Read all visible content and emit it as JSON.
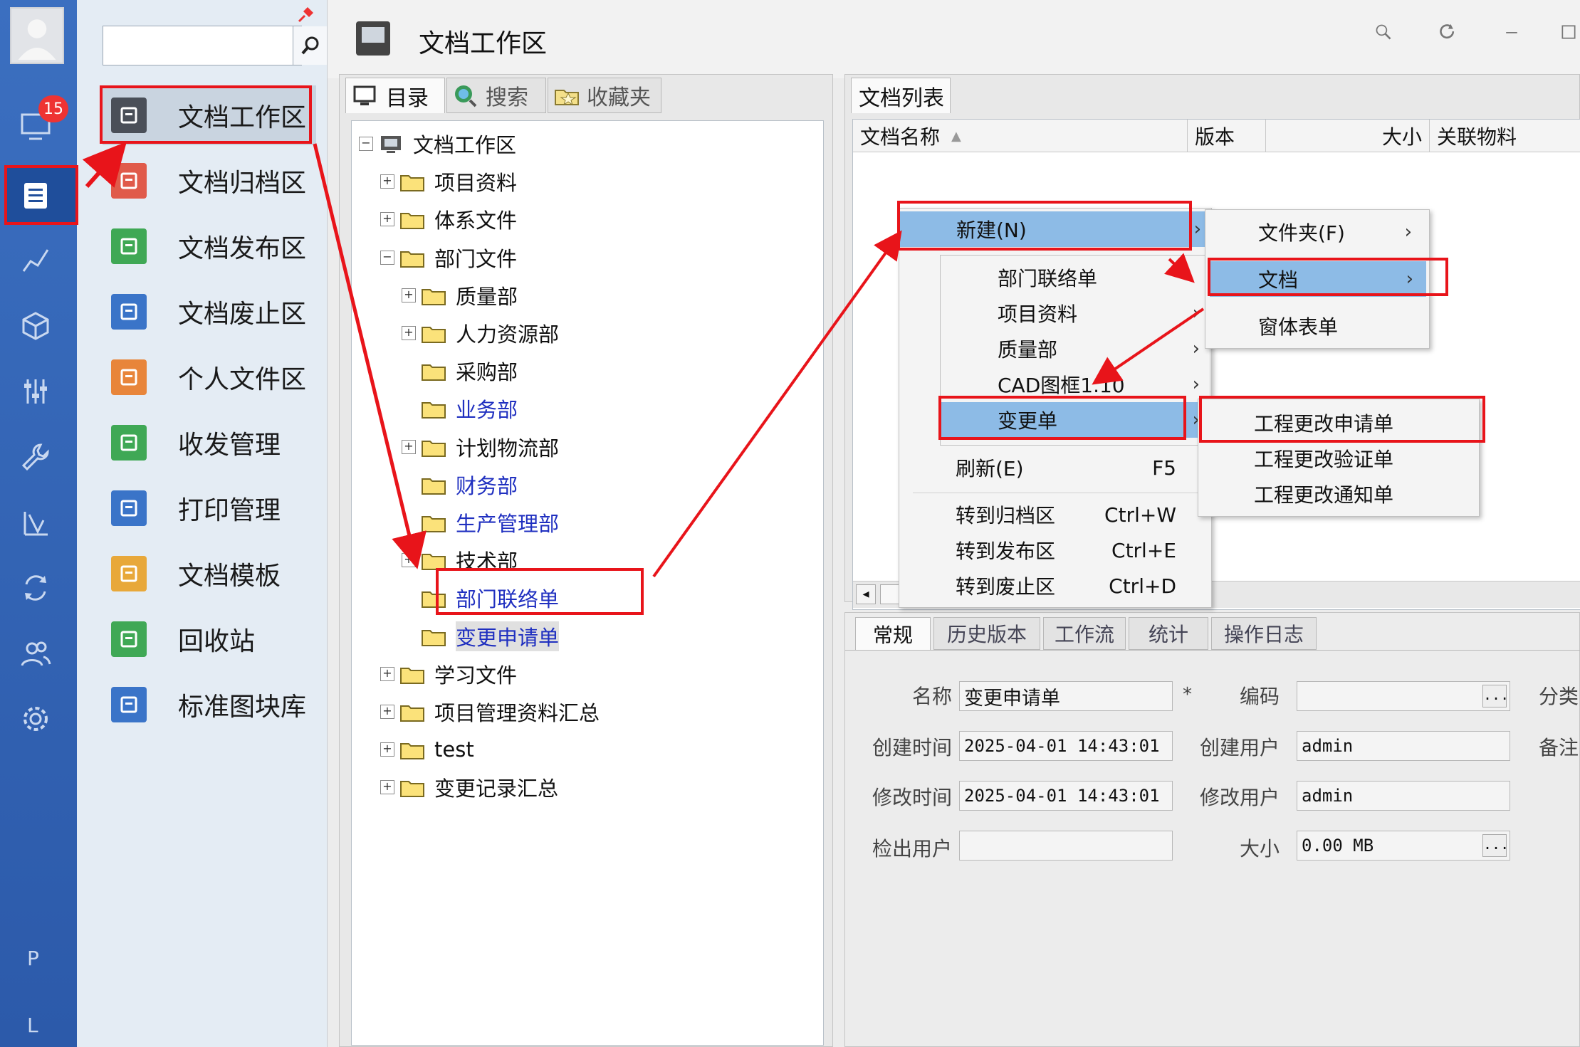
{
  "rail": {
    "badge": "15",
    "bottom_labels": [
      "P",
      "L"
    ]
  },
  "nav": {
    "search_placeholder": "",
    "items": [
      {
        "label": "文档工作区",
        "color": "#4a4f58"
      },
      {
        "label": "文档归档区",
        "color": "#e05a4a"
      },
      {
        "label": "文档发布区",
        "color": "#3fa855"
      },
      {
        "label": "文档废止区",
        "color": "#3a74c8"
      },
      {
        "label": "个人文件区",
        "color": "#e8853a"
      },
      {
        "label": "收发管理",
        "color": "#3fa855"
      },
      {
        "label": "打印管理",
        "color": "#3a74c8"
      },
      {
        "label": "文档模板",
        "color": "#e8a83a"
      },
      {
        "label": "回收站",
        "color": "#3fa855"
      },
      {
        "label": "标准图块库",
        "color": "#3a74c8"
      }
    ]
  },
  "header": {
    "title": "文档工作区"
  },
  "tree_tabs": [
    "目录",
    "搜索",
    "收藏夹"
  ],
  "tree": [
    {
      "label": "文档工作区",
      "level": 0,
      "exp": "⊟",
      "root": true
    },
    {
      "label": "项目资料",
      "level": 1,
      "exp": "+"
    },
    {
      "label": "体系文件",
      "level": 1,
      "exp": "+"
    },
    {
      "label": "部门文件",
      "level": 1,
      "exp": "−"
    },
    {
      "label": "质量部",
      "level": 2,
      "exp": "+"
    },
    {
      "label": "人力资源部",
      "level": 2,
      "exp": "+"
    },
    {
      "label": "采购部",
      "level": 2,
      "exp": ""
    },
    {
      "label": "业务部",
      "level": 2,
      "exp": "",
      "blue": true
    },
    {
      "label": "计划物流部",
      "level": 2,
      "exp": "+"
    },
    {
      "label": "财务部",
      "level": 2,
      "exp": "",
      "blue": true
    },
    {
      "label": "生产管理部",
      "level": 2,
      "exp": "",
      "blue": true
    },
    {
      "label": "技术部",
      "level": 2,
      "exp": "+"
    },
    {
      "label": "部门联络单",
      "level": 2,
      "exp": "",
      "blue": true
    },
    {
      "label": "变更申请单",
      "level": 2,
      "exp": "",
      "blue": true,
      "sel": true
    },
    {
      "label": "学习文件",
      "level": 1,
      "exp": "+"
    },
    {
      "label": "项目管理资料汇总",
      "level": 1,
      "exp": "+"
    },
    {
      "label": "test",
      "level": 1,
      "exp": "+"
    },
    {
      "label": "变更记录汇总",
      "level": 1,
      "exp": "+"
    }
  ],
  "list": {
    "tab": "文档列表",
    "columns": [
      "文档名称",
      "版本",
      "大小",
      "关联物料"
    ],
    "sort_indicator": "▲"
  },
  "context_menu": {
    "new": "新建(N)",
    "new_items": [
      "部门联络单",
      "项目资料",
      "质量部",
      "CAD图框1.10",
      "变更单"
    ],
    "refresh": "刷新(E)",
    "refresh_key": "F5",
    "actions": [
      {
        "label": "转到归档区",
        "key": "Ctrl+W"
      },
      {
        "label": "转到发布区",
        "key": "Ctrl+E"
      },
      {
        "label": "转到废止区",
        "key": "Ctrl+D"
      }
    ]
  },
  "new_submenu": [
    "文件夹(F)",
    "文档",
    "窗体表单"
  ],
  "change_submenu": [
    "工程更改申请单",
    "工程更改验证单",
    "工程更改通知单"
  ],
  "detail": {
    "tabs": [
      "常规",
      "历史版本",
      "工作流",
      "统计",
      "操作日志"
    ],
    "name_label": "名称",
    "name_value": "变更申请单",
    "required": "*",
    "code_label": "编码",
    "code_value": "",
    "category_label": "分类",
    "remark_label": "备注",
    "created_label": "创建时间",
    "created_value": "2025-04-01 14:43:01",
    "creator_label": "创建用户",
    "creator_value": "admin",
    "modified_label": "修改时间",
    "modified_value": "2025-04-01 14:43:01",
    "modifier_label": "修改用户",
    "modifier_value": "admin",
    "checkout_label": "检出用户",
    "checkout_value": "",
    "size_label": "大小",
    "size_value": "0.00 MB",
    "dots": "..."
  }
}
